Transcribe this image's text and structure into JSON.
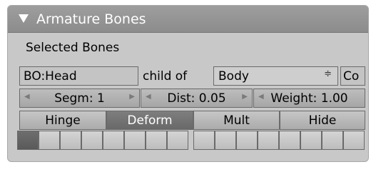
{
  "panel": {
    "title": "Armature Bones"
  },
  "selected_bones": {
    "section_label": "Selected Bones",
    "bone_name": "BO:Head",
    "child_of_label": "child of",
    "parent": "Body",
    "connect_label": "Co"
  },
  "numbers": {
    "segments": "Segm: 1",
    "dist": "Dist: 0.05",
    "weight": "Weight: 1.00"
  },
  "toggles": [
    {
      "label": "Hinge",
      "active": false
    },
    {
      "label": "Deform",
      "active": true
    },
    {
      "label": "Mult",
      "active": false
    },
    {
      "label": "Hide",
      "active": false
    }
  ],
  "layers": {
    "count": 16,
    "active": [
      1
    ]
  }
}
